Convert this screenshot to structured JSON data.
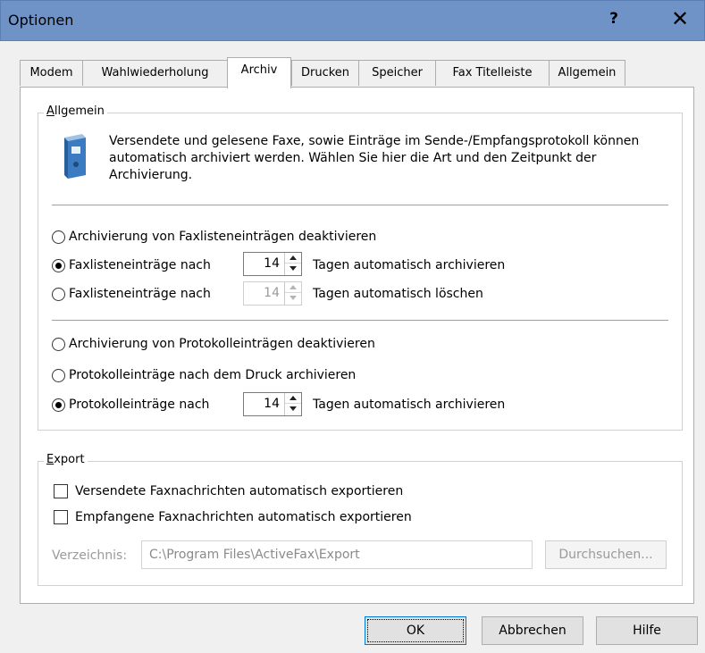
{
  "window": {
    "title": "Optionen",
    "help_label": "?",
    "close_label": "✕"
  },
  "tabs": [
    {
      "label": "Modem"
    },
    {
      "label": "Wahlwiederholung"
    },
    {
      "label": "Archiv"
    },
    {
      "label": "Drucken"
    },
    {
      "label": "Speicher"
    },
    {
      "label": "Fax Titelleiste"
    },
    {
      "label": "Allgemein"
    }
  ],
  "general": {
    "legend_mnemonic": "A",
    "legend_rest": "llgemein",
    "icon": "binder-icon",
    "description": "Versendete und gelesene Faxe, sowie Einträge im Sende-/Empfangsprotokoll können automatisch archiviert werden. Wählen Sie hier die Art und den Zeitpunkt der Archivierung.",
    "fax": {
      "opt_disable": "Archivierung von Faxlisteneinträgen deaktivieren",
      "opt_archive_label": "Faxlisteneinträge nach",
      "opt_archive_value": "14",
      "opt_archive_suffix": "Tagen automatisch archivieren",
      "opt_delete_label": "Faxlisteneinträge nach",
      "opt_delete_value": "14",
      "opt_delete_suffix": "Tagen automatisch löschen"
    },
    "protocol": {
      "opt_disable": "Archivierung von Protokolleinträgen deaktivieren",
      "opt_after_print": "Protokolleinträge nach dem Druck archivieren",
      "opt_archive_label": "Protokolleinträge nach",
      "opt_archive_value": "14",
      "opt_archive_suffix": "Tagen automatisch archivieren"
    }
  },
  "export": {
    "legend_mnemonic": "E",
    "legend_rest": "xport",
    "chk_sent": "Versendete Faxnachrichten automatisch exportieren",
    "chk_received": "Empfangene Faxnachrichten automatisch exportieren",
    "dir_label": "Verzeichnis:",
    "dir_value": "C:\\Program Files\\ActiveFax\\Export",
    "browse_label": "Durchsuchen..."
  },
  "buttons": {
    "ok": "OK",
    "cancel": "Abbrechen",
    "help": "Hilfe"
  }
}
